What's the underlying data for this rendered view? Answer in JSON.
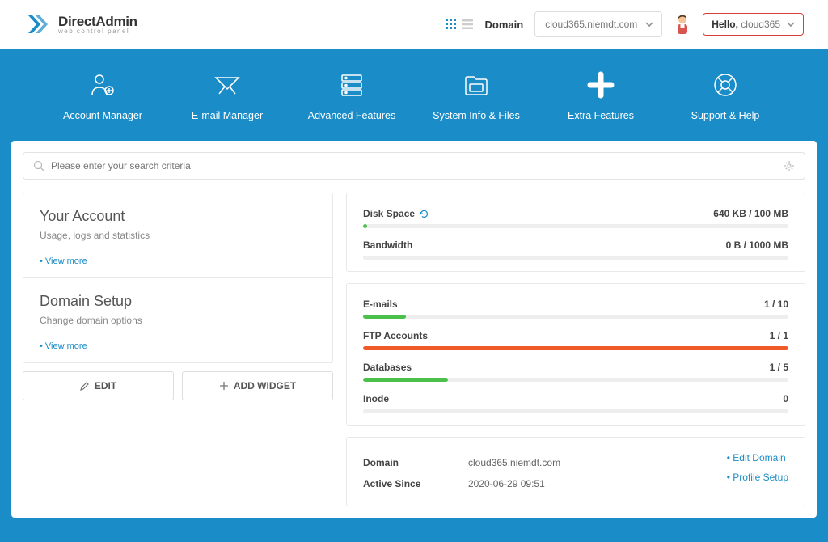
{
  "brand": {
    "name": "DirectAdmin",
    "sub": "web control panel"
  },
  "header": {
    "domain_label": "Domain",
    "domain_value": "cloud365.niemdt.com",
    "hello": "Hello,",
    "username": "cloud365"
  },
  "nav": [
    {
      "label": "Account Manager"
    },
    {
      "label": "E-mail Manager"
    },
    {
      "label": "Advanced Features"
    },
    {
      "label": "System Info & Files"
    },
    {
      "label": "Extra Features"
    },
    {
      "label": "Support & Help"
    }
  ],
  "search": {
    "placeholder": "Please enter your search criteria"
  },
  "left": {
    "account": {
      "title": "Your Account",
      "sub": "Usage, logs and statistics",
      "more": "View more"
    },
    "domain": {
      "title": "Domain Setup",
      "sub": "Change domain options",
      "more": "View more"
    },
    "edit_btn": "EDIT",
    "add_btn": "ADD WIDGET"
  },
  "stats_top": [
    {
      "name": "Disk Space",
      "value": "640 KB / 100 MB",
      "pct": 1,
      "color": "#4bc14b",
      "refresh": true
    },
    {
      "name": "Bandwidth",
      "value": "0 B / 1000 MB",
      "pct": 0,
      "color": "#4bc14b"
    }
  ],
  "stats_mid": [
    {
      "name": "E-mails",
      "value": "1 / 10",
      "pct": 10,
      "color": "#4bc14b"
    },
    {
      "name": "FTP Accounts",
      "value": "1 / 1",
      "pct": 100,
      "color": "#f05a28"
    },
    {
      "name": "Databases",
      "value": "1 / 5",
      "pct": 20,
      "color": "#4bc14b"
    },
    {
      "name": "Inode",
      "value": "0",
      "pct": 0,
      "color": "#4bc14b"
    }
  ],
  "info": {
    "domain_label": "Domain",
    "domain_value": "cloud365.niemdt.com",
    "active_label": "Active Since",
    "active_value": "2020-06-29 09:51",
    "link1": "Edit Domain",
    "link2": "Profile Setup"
  }
}
